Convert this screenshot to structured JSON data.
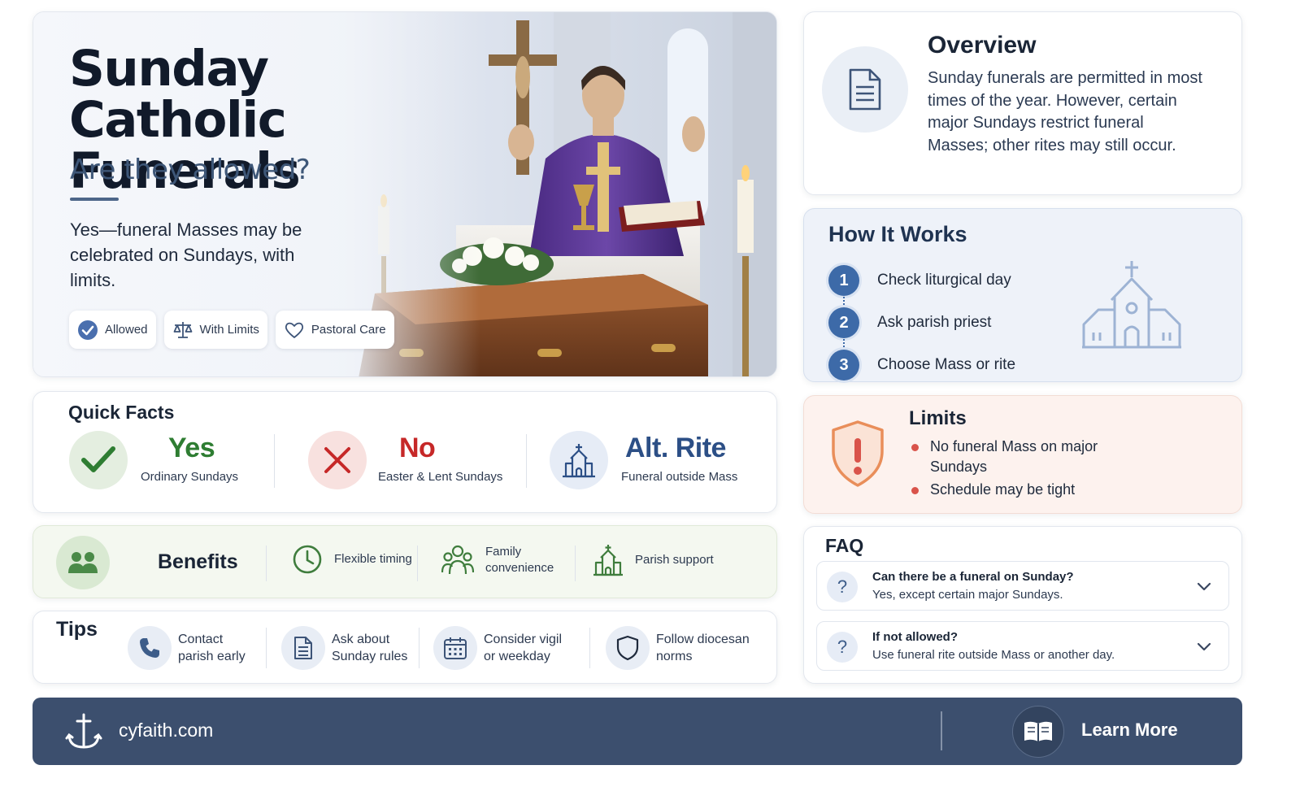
{
  "hero": {
    "title_line1": "Sunday",
    "title_line2": "Catholic Funerals",
    "subtitle": "Are they allowed?",
    "lead": "Yes—funeral Masses may be celebrated on Sundays, with limits.",
    "chips": [
      {
        "label": "Allowed",
        "icon": "check-circle-icon"
      },
      {
        "label": "With Limits",
        "icon": "scales-icon"
      },
      {
        "label": "Pastoral Care",
        "icon": "heart-icon"
      }
    ]
  },
  "overview": {
    "title": "Overview",
    "text": "Sunday funerals are permitted in most times of the year. However, certain major Sundays restrict funeral Masses; other rites may still occur.",
    "icon": "document-icon"
  },
  "how_it_works": {
    "title": "How It Works",
    "steps": [
      {
        "num": "1",
        "label": "Check liturgical day"
      },
      {
        "num": "2",
        "label": "Ask parish priest"
      },
      {
        "num": "3",
        "label": "Choose Mass or rite"
      }
    ],
    "icon": "church-icon"
  },
  "quick_facts": {
    "title": "Quick Facts",
    "items": [
      {
        "big": "Yes",
        "small": "Ordinary Sundays",
        "color": "#2e7d32"
      },
      {
        "big": "No",
        "small": "Easter & Lent Sundays",
        "color": "#c62828"
      },
      {
        "big": "Alt. Rite",
        "small": "Funeral outside Mass",
        "color": "#2c4f86"
      }
    ]
  },
  "benefits": {
    "title": "Benefits",
    "items": [
      {
        "label": "Flexible timing",
        "icon": "clock-icon"
      },
      {
        "label": "Family convenience",
        "icon": "family-icon"
      },
      {
        "label": "Parish support",
        "icon": "church-icon"
      }
    ]
  },
  "tips": {
    "title": "Tips",
    "items": [
      {
        "label": "Contact parish early",
        "icon": "phone-icon"
      },
      {
        "label": "Ask about Sunday rules",
        "icon": "document-icon"
      },
      {
        "label": "Consider vigil or weekday",
        "icon": "calendar-icon"
      },
      {
        "label": "Follow diocesan norms",
        "icon": "shield-icon"
      }
    ]
  },
  "limits": {
    "title": "Limits",
    "items": [
      "No funeral Mass on major Sundays",
      "Schedule may be tight"
    ]
  },
  "faq": {
    "title": "FAQ",
    "items": [
      {
        "q": "Can there be a funeral on Sunday?",
        "a": "Yes, except certain major Sundays."
      },
      {
        "q": "If not allowed?",
        "a": "Use funeral rite outside Mass or another day."
      }
    ]
  },
  "footer": {
    "site": "cyfaith.com",
    "cta": "Learn More"
  },
  "colors": {
    "navy": "#3c4f6e",
    "accent_blue": "#3d6aa8",
    "yes_green": "#2e7d32",
    "no_red": "#c62828",
    "limits_bg": "#fdf2ee",
    "benefits_bg": "#f4f8f0"
  }
}
